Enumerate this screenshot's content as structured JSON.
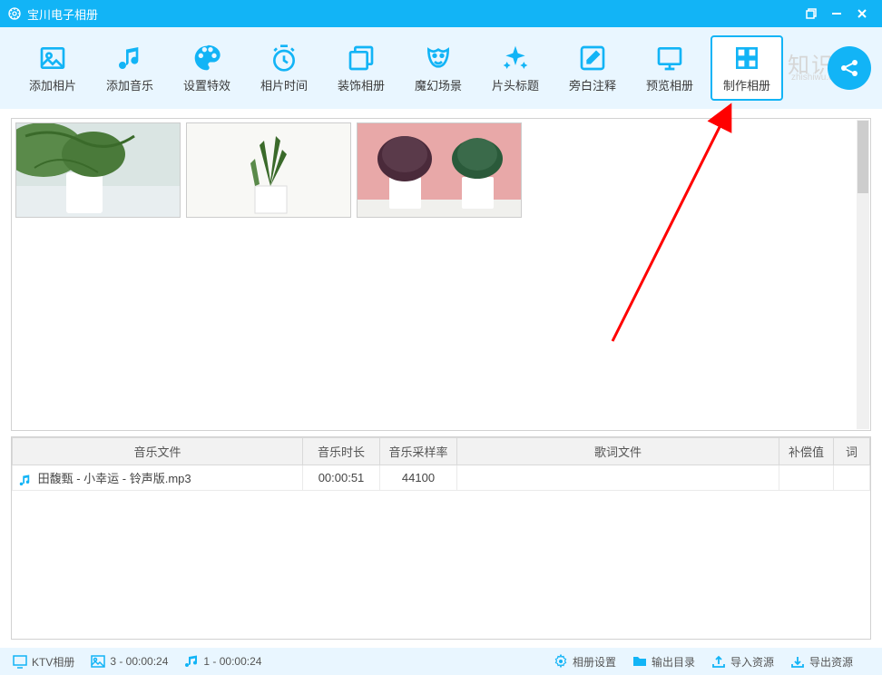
{
  "titlebar": {
    "app_name": "宝川电子相册"
  },
  "toolbar": {
    "buttons": [
      {
        "label": "添加相片"
      },
      {
        "label": "添加音乐"
      },
      {
        "label": "设置特效"
      },
      {
        "label": "相片时间"
      },
      {
        "label": "装饰相册"
      },
      {
        "label": "魔幻场景"
      },
      {
        "label": "片头标题"
      },
      {
        "label": "旁白注释"
      },
      {
        "label": "预览相册"
      },
      {
        "label": "制作相册"
      }
    ]
  },
  "watermark": {
    "text": "知识屋",
    "sub": "zhishiwu.com"
  },
  "photos": {
    "count": 3
  },
  "music_table": {
    "headers": {
      "file": "音乐文件",
      "duration": "音乐时长",
      "sample_rate": "音乐采样率",
      "lyric": "歌词文件",
      "offset": "补偿值",
      "ci": "词"
    },
    "rows": [
      {
        "file": "田馥甄 - 小幸运 - 铃声版.mp3",
        "duration": "00:00:51",
        "sample_rate": "44100",
        "lyric": "",
        "offset": ""
      }
    ]
  },
  "statusbar": {
    "album_type": "KTV相册",
    "photo_info": "3 - 00:00:24",
    "music_info": "1 - 00:00:24",
    "settings": "相册设置",
    "output_dir": "输出目录",
    "import": "导入资源",
    "export": "导出资源"
  }
}
